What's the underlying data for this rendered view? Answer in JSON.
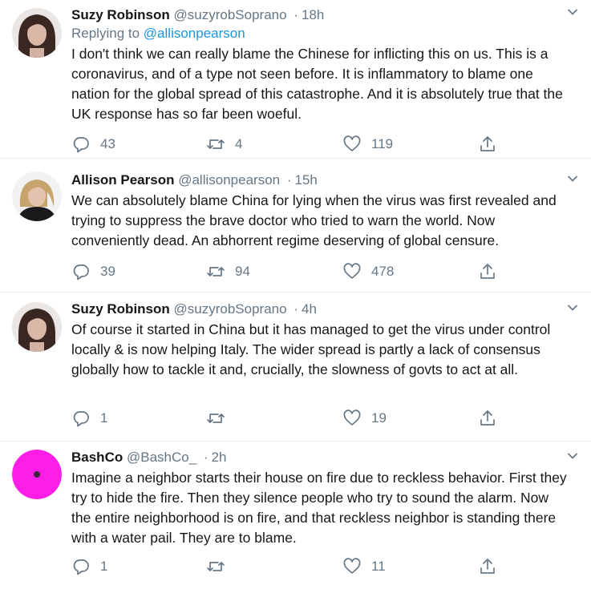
{
  "tweets": [
    {
      "name": "Suzy Robinson",
      "handle": "@suzyrobSoprano",
      "time": "18h",
      "replying_label": "Replying to",
      "replying_to": "@allisonpearson",
      "text": "I don't think we can really blame the Chinese for inflicting this on us. This is a coronavirus, and of a type not seen before. It is inflammatory to blame one nation for the global spread of this catastrophe. And it is absolutely true that the UK response has so far been woeful.",
      "replies": "43",
      "retweets": "4",
      "likes": "119"
    },
    {
      "name": "Allison Pearson",
      "handle": "@allisonpearson",
      "time": "15h",
      "text": "We can absolutely blame China for lying when the virus was first revealed and trying to suppress the brave doctor who tried to warn the world. Now conveniently dead. An abhorrent regime deserving of global censure.",
      "replies": "39",
      "retweets": "94",
      "likes": "478"
    },
    {
      "name": "Suzy Robinson",
      "handle": "@suzyrobSoprano",
      "time": "4h",
      "text": "Of course it started in China but it has managed to get the virus under control locally & is now helping Italy. The wider spread is partly a lack of consensus globally how to tackle it and, crucially, the slowness of govts to act at all.",
      "replies": "1",
      "retweets": "",
      "likes": "19"
    },
    {
      "name": "BashCo",
      "handle": "@BashCo_",
      "time": "2h",
      "text": "Imagine a neighbor starts their house on fire due to reckless behavior. First they try to hide the fire. Then they silence people who try to sound the alarm. Now the entire neighborhood is on fire, and that reckless neighbor is standing there with a water pail. They are to blame.",
      "replies": "1",
      "retweets": "",
      "likes": "11"
    }
  ],
  "separator": "·",
  "colors": {
    "text": "#14171a",
    "secondary": "#657786",
    "link": "#1b95e0",
    "border": "#e6ecf0",
    "bashco_avatar": "#ff1ee8"
  },
  "icons": [
    "reply-icon",
    "retweet-icon",
    "like-icon",
    "share-icon",
    "caret-down-icon"
  ]
}
